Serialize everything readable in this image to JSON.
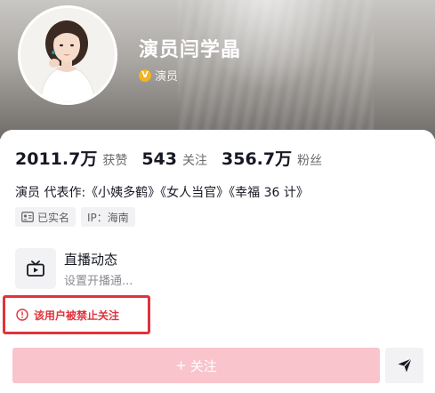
{
  "profile": {
    "name": "演员闫学晶",
    "verification": "演员"
  },
  "stats": [
    {
      "value": "2011.7万",
      "label": "获赞"
    },
    {
      "value": "543",
      "label": "关注"
    },
    {
      "value": "356.7万",
      "label": "粉丝"
    }
  ],
  "bio": "演员 代表作:《小姨多鹤》《女人当官》《幸福 36 计》",
  "tags": {
    "real_name": "已实名",
    "ip": "IP：海南"
  },
  "live": {
    "title": "直播动态",
    "subtitle": "设置开播通..."
  },
  "notice": {
    "banned": "该用户被禁止关注"
  },
  "actions": {
    "follow_plus": "+",
    "follow_label": "关注"
  },
  "colors": {
    "accent_red": "#e0333b",
    "follow_disabled": "#f9c4cc",
    "verify_gold": "#f2b322"
  }
}
